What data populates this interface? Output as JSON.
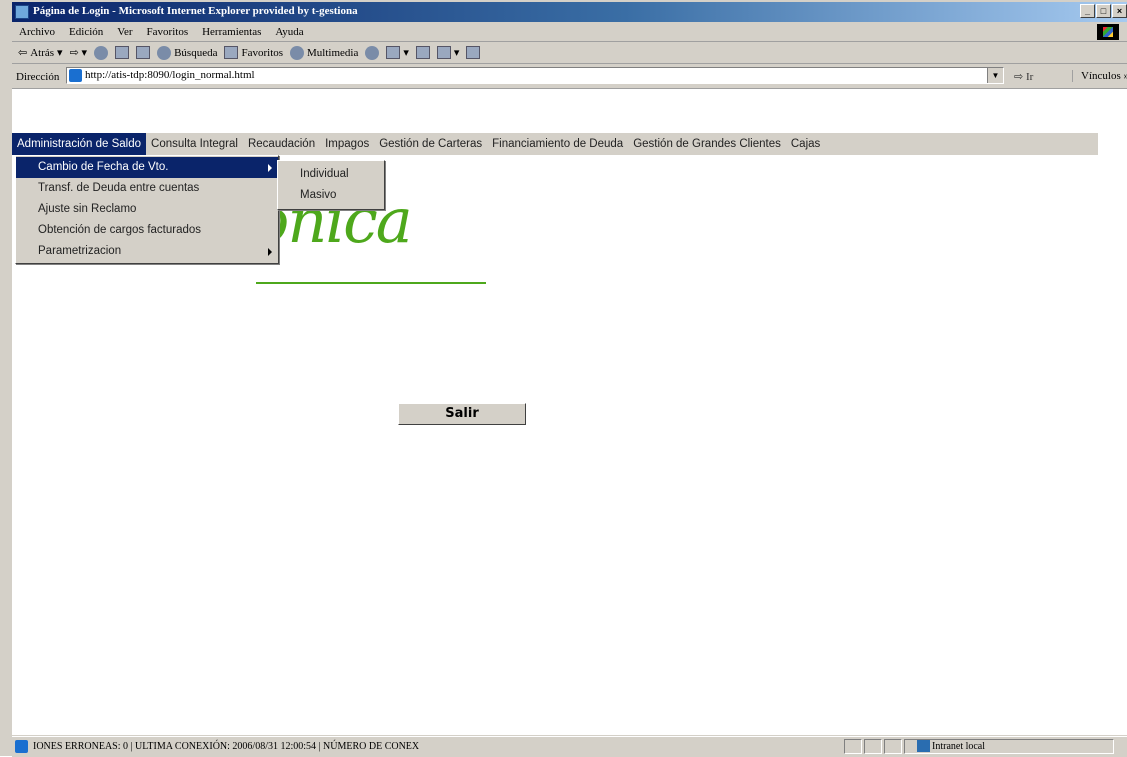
{
  "window": {
    "title": "Página de Login - Microsoft Internet Explorer provided by t-gestiona",
    "controls": [
      "_",
      "□",
      "×"
    ]
  },
  "menubar": [
    "Archivo",
    "Edición",
    "Ver",
    "Favoritos",
    "Herramientas",
    "Ayuda"
  ],
  "toolbar": {
    "back": "Atrás",
    "search": "Búsqueda",
    "favorites": "Favoritos",
    "multimedia": "Multimedia"
  },
  "address": {
    "label": "Dirección",
    "url": "http://atis-tdp:8090/login_normal.html",
    "go": "Ir",
    "links": "Vínculos"
  },
  "appnav": [
    "Administración de Saldo",
    "Consulta Integral",
    "Recaudación",
    "Impagos",
    "Gestión de Carteras",
    "Financiamiento de Deuda",
    "Gestión de Grandes Clientes",
    "Cajas"
  ],
  "dropdown": [
    "Cambio de Fecha de Vto.",
    "Transf. de Deuda entre cuentas",
    "Ajuste sin Reclamo",
    "Obtención de cargos facturados",
    "Parametrizacion"
  ],
  "submenu": [
    "Individual",
    "Masivo"
  ],
  "logo": {
    "text": "onica"
  },
  "button": {
    "salir": "Salir"
  },
  "status": {
    "text": "IONES ERRONEAS: 0 | ULTIMA CONEXIÓN: 2006/08/31 12:00:54 | NÚMERO DE CONEX",
    "zone": "Intranet local"
  },
  "colors": {
    "accent": "#0a246a",
    "logo": "#4ea81c",
    "chrome": "#d4d0c8"
  }
}
